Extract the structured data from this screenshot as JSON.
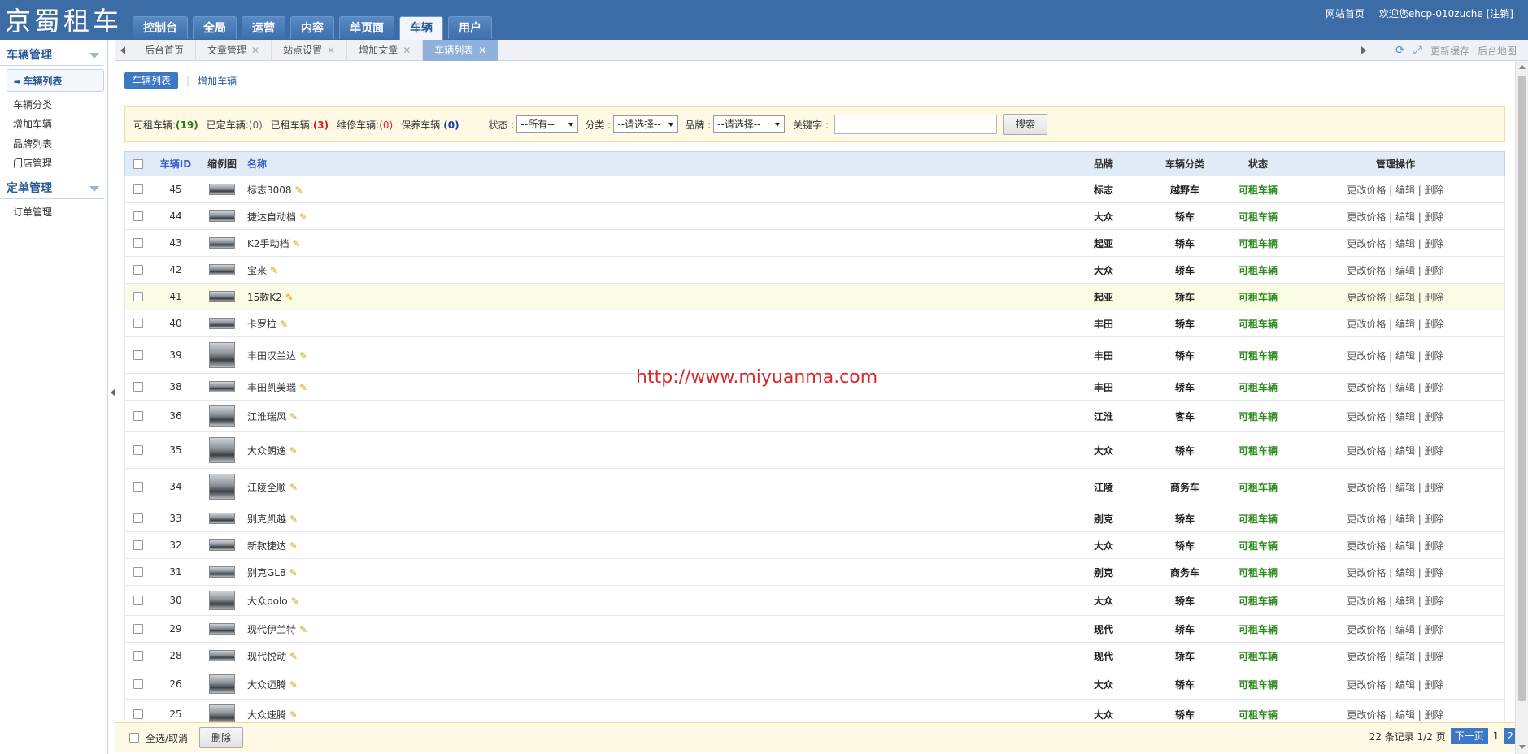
{
  "app": {
    "logo": "京蜀租车",
    "nav": [
      "控制台",
      "全局",
      "运营",
      "内容",
      "单页面",
      "车辆",
      "用户"
    ],
    "nav_active": "车辆",
    "top_links": {
      "home": "网站首页",
      "welcome": "欢迎您ehcp-010zuche",
      "logout": "[注销]"
    }
  },
  "sidebar": {
    "groups": [
      {
        "title": "车辆管理",
        "items": [
          "车辆列表",
          "车辆分类",
          "增加车辆",
          "品牌列表",
          "门店管理"
        ]
      },
      {
        "title": "定单管理",
        "items": [
          "订单管理"
        ]
      }
    ]
  },
  "open_tabs": [
    "后台首页",
    "文章管理",
    "站点设置",
    "增加文章",
    "车辆列表"
  ],
  "tab_tools": {
    "refresh_cache": "更新缓存",
    "admin_map": "后台地图"
  },
  "subtabs": {
    "active": "车辆列表",
    "other": "增加车辆"
  },
  "filters": {
    "stats": [
      {
        "label": "可租车辆:",
        "value": "(19)",
        "color": "green"
      },
      {
        "label": "已定车辆:",
        "value": "(0)",
        "color": "gray"
      },
      {
        "label": "已租车辆:",
        "value": "(3)",
        "color": "red"
      },
      {
        "label": "维修车辆:",
        "value": "(0)",
        "color": "red"
      },
      {
        "label": "保养车辆:",
        "value": "(0)",
        "color": "blue"
      }
    ],
    "status_label": "状态 :",
    "status_value": "--所有--",
    "category_label": "分类 :",
    "category_value": "--请选择--",
    "brand_label": "品牌 :",
    "brand_value": "--请选择--",
    "keyword_label": "关键字 :",
    "keyword_value": "",
    "search_button": "搜索"
  },
  "table": {
    "headers": {
      "id": "车辆ID",
      "thumb": "缩例图",
      "name": "名称",
      "brand": "品牌",
      "category": "车辆分类",
      "status": "状态",
      "ops": "管理操作"
    },
    "rows": [
      {
        "id": "45",
        "name": "标志3008",
        "brand": "标志",
        "category": "越野车",
        "status": "可租车辆",
        "ops": "更改价格 | 编辑 | 删除"
      },
      {
        "id": "44",
        "name": "捷达自动档",
        "brand": "大众",
        "category": "轿车",
        "status": "可租车辆",
        "ops": "更改价格 | 编辑 | 删除"
      },
      {
        "id": "43",
        "name": "K2手动档",
        "brand": "起亚",
        "category": "轿车",
        "status": "可租车辆",
        "ops": "更改价格 | 编辑 | 删除"
      },
      {
        "id": "42",
        "name": "宝来",
        "brand": "大众",
        "category": "轿车",
        "status": "可租车辆",
        "ops": "更改价格 | 编辑 | 删除"
      },
      {
        "id": "41",
        "name": "15款K2",
        "brand": "起亚",
        "category": "轿车",
        "status": "可租车辆",
        "ops": "更改价格 | 编辑 | 删除"
      },
      {
        "id": "40",
        "name": "卡罗拉",
        "brand": "丰田",
        "category": "轿车",
        "status": "可租车辆",
        "ops": "更改价格 | 编辑 | 删除"
      },
      {
        "id": "39",
        "name": "丰田汉兰达",
        "brand": "丰田",
        "category": "轿车",
        "status": "可租车辆",
        "ops": "更改价格 | 编辑 | 删除"
      },
      {
        "id": "38",
        "name": "丰田凯美瑞",
        "brand": "丰田",
        "category": "轿车",
        "status": "可租车辆",
        "ops": "更改价格 | 编辑 | 删除"
      },
      {
        "id": "36",
        "name": "江淮瑞风",
        "brand": "江淮",
        "category": "客车",
        "status": "可租车辆",
        "ops": "更改价格 | 编辑 | 删除"
      },
      {
        "id": "35",
        "name": "大众朗逸",
        "brand": "大众",
        "category": "轿车",
        "status": "可租车辆",
        "ops": "更改价格 | 编辑 | 删除"
      },
      {
        "id": "34",
        "name": "江陵全顺",
        "brand": "江陵",
        "category": "商务车",
        "status": "可租车辆",
        "ops": "更改价格 | 编辑 | 删除"
      },
      {
        "id": "33",
        "name": "别克凯越",
        "brand": "别克",
        "category": "轿车",
        "status": "可租车辆",
        "ops": "更改价格 | 编辑 | 删除"
      },
      {
        "id": "32",
        "name": "新款捷达",
        "brand": "大众",
        "category": "轿车",
        "status": "可租车辆",
        "ops": "更改价格 | 编辑 | 删除"
      },
      {
        "id": "31",
        "name": "别克GL8",
        "brand": "别克",
        "category": "商务车",
        "status": "可租车辆",
        "ops": "更改价格 | 编辑 | 删除"
      },
      {
        "id": "30",
        "name": "大众polo",
        "brand": "大众",
        "category": "轿车",
        "status": "可租车辆",
        "ops": "更改价格 | 编辑 | 删除"
      },
      {
        "id": "29",
        "name": "现代伊兰特",
        "brand": "现代",
        "category": "轿车",
        "status": "可租车辆",
        "ops": "更改价格 | 编辑 | 删除"
      },
      {
        "id": "28",
        "name": "现代悦动",
        "brand": "现代",
        "category": "轿车",
        "status": "可租车辆",
        "ops": "更改价格 | 编辑 | 删除"
      },
      {
        "id": "26",
        "name": "大众迈腾",
        "brand": "大众",
        "category": "轿车",
        "status": "可租车辆",
        "ops": "更改价格 | 编辑 | 删除"
      },
      {
        "id": "25",
        "name": "大众速腾",
        "brand": "大众",
        "category": "轿车",
        "status": "可租车辆",
        "ops": "更改价格 | 编辑 | 删除"
      }
    ]
  },
  "watermark": "http://www.miyuanma.com",
  "footer": {
    "select_all": "全选/取消",
    "delete_button": "删除",
    "records": "22 条记录 1/2 页",
    "next": "下一页",
    "pages": [
      "1",
      "2"
    ]
  },
  "colors": {
    "header": "#3c6ca6",
    "accent": "#3c78c4",
    "status_green": "#2e8b1f",
    "filter_bg": "#fdf9e4"
  }
}
